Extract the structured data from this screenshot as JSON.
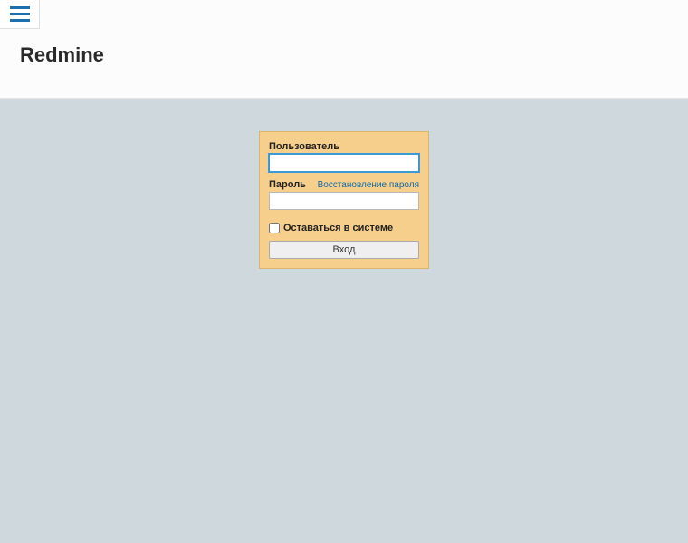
{
  "header": {
    "title": "Redmine"
  },
  "login": {
    "username_label": "Пользователь",
    "username_value": "",
    "password_label": "Пароль",
    "password_value": "",
    "lost_password_label": "Восстановление пароля",
    "remember_label": "Оставаться в системе",
    "submit_label": "Вход"
  },
  "colors": {
    "header_bg": "#fcfcfc",
    "body_bg": "#cfd9dd",
    "box_bg": "#f7cf8d",
    "box_border": "#d9b66b",
    "link": "#0d6aa8",
    "menu_icon": "#1c6fb0"
  }
}
